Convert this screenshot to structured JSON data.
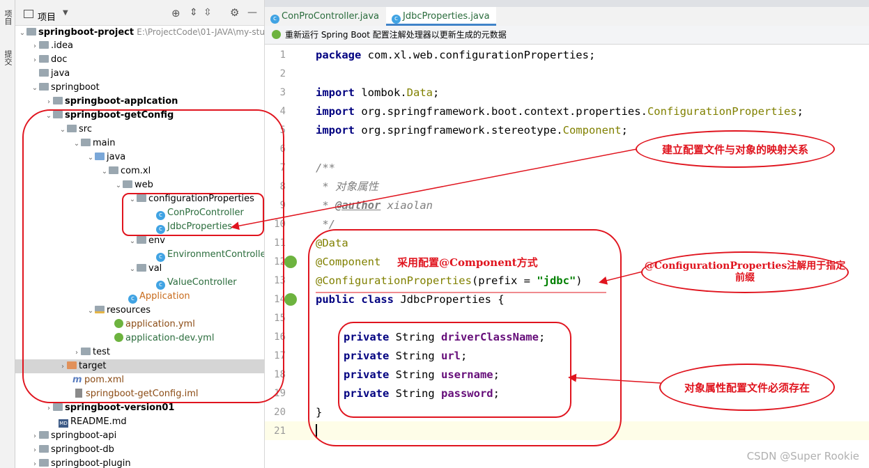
{
  "toolstrip": {
    "project_tab": "项目",
    "commit_tab": "提交"
  },
  "project_panel": {
    "title": "项目",
    "root": {
      "name": "springboot-project",
      "path": "E:\\ProjectCode\\01-JAVA\\my-study"
    },
    "items": [
      {
        "label": ".idea"
      },
      {
        "label": "doc"
      },
      {
        "label": "java"
      },
      {
        "label": "springboot"
      },
      {
        "label": "springboot-applcation"
      },
      {
        "label": "springboot-getConfig"
      },
      {
        "label": "src"
      },
      {
        "label": "main"
      },
      {
        "label": "java"
      },
      {
        "label": "com.xl"
      },
      {
        "label": "web"
      },
      {
        "label": "configurationProperties"
      },
      {
        "label": "ConProController"
      },
      {
        "label": "JdbcProperties"
      },
      {
        "label": "env"
      },
      {
        "label": "EnvironmentController"
      },
      {
        "label": "val"
      },
      {
        "label": "ValueController"
      },
      {
        "label": "Application"
      },
      {
        "label": "resources"
      },
      {
        "label": "application.yml"
      },
      {
        "label": "application-dev.yml"
      },
      {
        "label": "test"
      },
      {
        "label": "target"
      },
      {
        "label": "pom.xml"
      },
      {
        "label": "springboot-getConfig.iml"
      },
      {
        "label": "springboot-version01"
      },
      {
        "label": "README.md"
      },
      {
        "label": "springboot-api"
      },
      {
        "label": "springboot-db"
      },
      {
        "label": "springboot-plugin"
      }
    ]
  },
  "editor": {
    "tabs": [
      {
        "label": "ConProController.java"
      },
      {
        "label": "JdbcProperties.java"
      }
    ],
    "notice": "重新运行 Spring Boot 配置注解处理器以更新生成的元数据",
    "line_numbers": [
      "1",
      "2",
      "3",
      "4",
      "5",
      "6",
      "7",
      "8",
      "9",
      "10",
      "11",
      "12",
      "13",
      "14",
      "15",
      "16",
      "17",
      "18",
      "19",
      "20",
      "21"
    ],
    "code": {
      "l1a": "package",
      "l1b": " com.xl.web.configurationProperties;",
      "l3a": "import",
      "l3b": " lombok.",
      "l3c": "Data",
      "l3d": ";",
      "l4a": "import",
      "l4b": " org.springframework.boot.context.properties.",
      "l4c": "ConfigurationProperties",
      "l4d": ";",
      "l5a": "import",
      "l5b": " org.springframework.stereotype.",
      "l5c": "Component",
      "l5d": ";",
      "l7": "/**",
      "l8": " * 对象属性",
      "l9a": " * ",
      "l9b": "@author",
      "l9c": " xiaolan",
      "l10": " */",
      "l11": "@Data",
      "l12": "@Component",
      "l13a": "@ConfigurationProperties",
      "l13b": "(prefix = ",
      "l13c": "\"jdbc\"",
      "l13d": ")",
      "l14a": "public class",
      "l14b": " JdbcProperties {",
      "l16a": "private",
      "l16b": " String ",
      "l16c": "driverClassName",
      "l16d": ";",
      "l17a": "private",
      "l17b": " String ",
      "l17c": "url",
      "l17d": ";",
      "l18a": "private",
      "l18b": " String ",
      "l18c": "username",
      "l18d": ";",
      "l19a": "private",
      "l19b": " String ",
      "l19c": "password",
      "l19d": ";",
      "l20": "}"
    }
  },
  "annotations": {
    "mapping": "建立配置文件与对象的映射关系",
    "component_way": "采用配置@Component方式",
    "config_props": "@ConfigurationProperties注解用于指定前缀",
    "must_exist": "对象属性配置文件必须存在"
  },
  "watermark": "CSDN @Super Rookie",
  "colors": {
    "annotation_red": "#e0141e",
    "tab_accent": "#4083c9"
  }
}
